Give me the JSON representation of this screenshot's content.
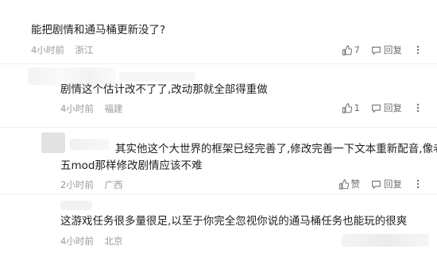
{
  "comments": [
    {
      "text": "能把剧情和通马桶更新没了?",
      "time": "4小时前",
      "location": "浙江",
      "likes": "7",
      "reply": "回复"
    },
    {
      "text": "剧情这个估计改不了了,改动那就全部得重做",
      "time": "4小时前",
      "location": "福建",
      "likes": "1",
      "reply": "回复"
    },
    {
      "text_line1": "其实他这个大世界的框架已经完善了,修改完善一下文本重新配音,像老滚",
      "text_line2": "五mod那样修改剧情应该不难",
      "time": "2小时前",
      "location": "广西",
      "likes": "赞",
      "reply": "回复"
    },
    {
      "text": "这游戏任务很多量很足,以至于你完全忽视你说的通马桶任务也能玩的很爽",
      "time": "4小时前",
      "location": "北京"
    }
  ],
  "icons": [
    "thumbs-up-icon",
    "chat-bubble-icon",
    "more-icon"
  ]
}
